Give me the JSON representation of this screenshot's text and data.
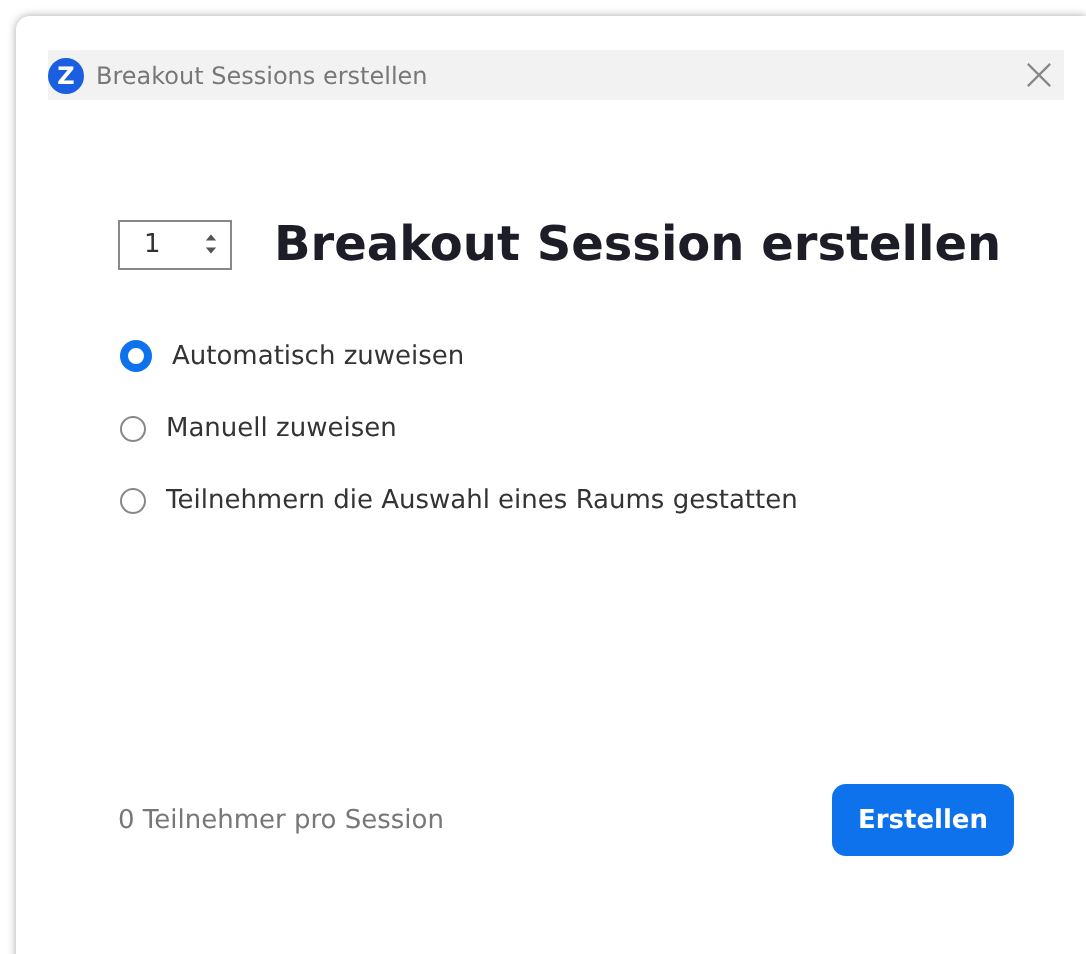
{
  "window": {
    "title": "Breakout Sessions erstellen",
    "logo": "Z"
  },
  "session_count": "1",
  "heading": "Breakout Session erstellen",
  "options": [
    {
      "label": "Automatisch zuweisen",
      "selected": true
    },
    {
      "label": "Manuell zuweisen",
      "selected": false
    },
    {
      "label": "Teilnehmern die Auswahl eines Raums gestatten",
      "selected": false
    }
  ],
  "footer": {
    "info": "0 Teilnehmer pro Session",
    "button": "Erstellen"
  }
}
